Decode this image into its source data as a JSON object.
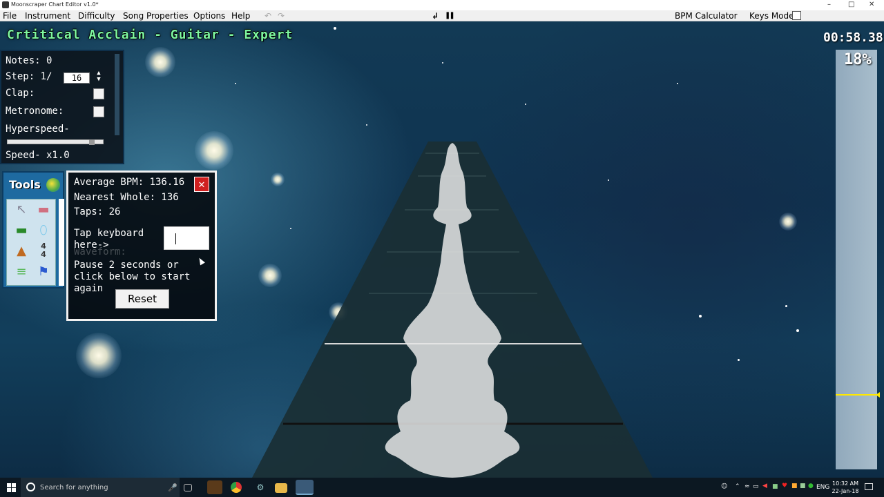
{
  "window": {
    "title": "Moonscraper Chart Editor v1.0*",
    "controls": [
      "–",
      "□",
      "✕"
    ]
  },
  "menu": {
    "items": [
      "File",
      "Instrument",
      "Difficulty",
      "Song Properties",
      "Options",
      "Help"
    ],
    "undo_icon": "↶",
    "redo_icon": "↷",
    "playback_icon": "↲",
    "pause_icon": "❚❚",
    "bpm_calculator": "BPM Calculator",
    "keys_mode": "Keys Mode:"
  },
  "chart": {
    "title": "Crtitical Acclain - Guitar - Expert",
    "time": "00:58.38",
    "progress_pct": "18%",
    "progress_value": 0.18
  },
  "info": {
    "notes": "Notes: 0",
    "step_label": "Step: 1/",
    "step_value": "16",
    "clap": "Clap:",
    "metronome": "Metronome:",
    "hyperspeed": "Hyperspeed-",
    "speed": "Speed- x1.0",
    "up_arrow": "▲",
    "down_arrow": "▼"
  },
  "tools": {
    "label": "Tools",
    "time_sig_top": "4",
    "time_sig_bottom": "4"
  },
  "bpm_calc": {
    "average": "Average BPM: 136.16",
    "nearest": "Nearest Whole: 136",
    "taps": "Taps: 26",
    "tap_line1": "Tap keyboard",
    "tap_line2": "here->",
    "waveform_ghost": "Waveform:",
    "pause_line1": "Pause 2 seconds or",
    "pause_line2": "click below to start",
    "pause_line3": "again",
    "reset": "Reset",
    "close": "✕"
  },
  "taskbar": {
    "search_placeholder": "Search for anything",
    "lang": "ENG",
    "time": "10:32 AM",
    "date": "22-Jan-18"
  }
}
